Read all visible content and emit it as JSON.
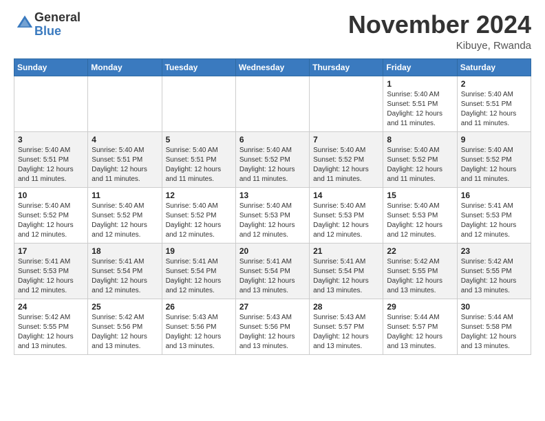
{
  "header": {
    "logo_line1": "General",
    "logo_line2": "Blue",
    "month": "November 2024",
    "location": "Kibuye, Rwanda"
  },
  "days_of_week": [
    "Sunday",
    "Monday",
    "Tuesday",
    "Wednesday",
    "Thursday",
    "Friday",
    "Saturday"
  ],
  "weeks": [
    [
      {
        "day": "",
        "info": ""
      },
      {
        "day": "",
        "info": ""
      },
      {
        "day": "",
        "info": ""
      },
      {
        "day": "",
        "info": ""
      },
      {
        "day": "",
        "info": ""
      },
      {
        "day": "1",
        "info": "Sunrise: 5:40 AM\nSunset: 5:51 PM\nDaylight: 12 hours\nand 11 minutes."
      },
      {
        "day": "2",
        "info": "Sunrise: 5:40 AM\nSunset: 5:51 PM\nDaylight: 12 hours\nand 11 minutes."
      }
    ],
    [
      {
        "day": "3",
        "info": "Sunrise: 5:40 AM\nSunset: 5:51 PM\nDaylight: 12 hours\nand 11 minutes."
      },
      {
        "day": "4",
        "info": "Sunrise: 5:40 AM\nSunset: 5:51 PM\nDaylight: 12 hours\nand 11 minutes."
      },
      {
        "day": "5",
        "info": "Sunrise: 5:40 AM\nSunset: 5:51 PM\nDaylight: 12 hours\nand 11 minutes."
      },
      {
        "day": "6",
        "info": "Sunrise: 5:40 AM\nSunset: 5:52 PM\nDaylight: 12 hours\nand 11 minutes."
      },
      {
        "day": "7",
        "info": "Sunrise: 5:40 AM\nSunset: 5:52 PM\nDaylight: 12 hours\nand 11 minutes."
      },
      {
        "day": "8",
        "info": "Sunrise: 5:40 AM\nSunset: 5:52 PM\nDaylight: 12 hours\nand 11 minutes."
      },
      {
        "day": "9",
        "info": "Sunrise: 5:40 AM\nSunset: 5:52 PM\nDaylight: 12 hours\nand 11 minutes."
      }
    ],
    [
      {
        "day": "10",
        "info": "Sunrise: 5:40 AM\nSunset: 5:52 PM\nDaylight: 12 hours\nand 12 minutes."
      },
      {
        "day": "11",
        "info": "Sunrise: 5:40 AM\nSunset: 5:52 PM\nDaylight: 12 hours\nand 12 minutes."
      },
      {
        "day": "12",
        "info": "Sunrise: 5:40 AM\nSunset: 5:52 PM\nDaylight: 12 hours\nand 12 minutes."
      },
      {
        "day": "13",
        "info": "Sunrise: 5:40 AM\nSunset: 5:53 PM\nDaylight: 12 hours\nand 12 minutes."
      },
      {
        "day": "14",
        "info": "Sunrise: 5:40 AM\nSunset: 5:53 PM\nDaylight: 12 hours\nand 12 minutes."
      },
      {
        "day": "15",
        "info": "Sunrise: 5:40 AM\nSunset: 5:53 PM\nDaylight: 12 hours\nand 12 minutes."
      },
      {
        "day": "16",
        "info": "Sunrise: 5:41 AM\nSunset: 5:53 PM\nDaylight: 12 hours\nand 12 minutes."
      }
    ],
    [
      {
        "day": "17",
        "info": "Sunrise: 5:41 AM\nSunset: 5:53 PM\nDaylight: 12 hours\nand 12 minutes."
      },
      {
        "day": "18",
        "info": "Sunrise: 5:41 AM\nSunset: 5:54 PM\nDaylight: 12 hours\nand 12 minutes."
      },
      {
        "day": "19",
        "info": "Sunrise: 5:41 AM\nSunset: 5:54 PM\nDaylight: 12 hours\nand 12 minutes."
      },
      {
        "day": "20",
        "info": "Sunrise: 5:41 AM\nSunset: 5:54 PM\nDaylight: 12 hours\nand 13 minutes."
      },
      {
        "day": "21",
        "info": "Sunrise: 5:41 AM\nSunset: 5:54 PM\nDaylight: 12 hours\nand 13 minutes."
      },
      {
        "day": "22",
        "info": "Sunrise: 5:42 AM\nSunset: 5:55 PM\nDaylight: 12 hours\nand 13 minutes."
      },
      {
        "day": "23",
        "info": "Sunrise: 5:42 AM\nSunset: 5:55 PM\nDaylight: 12 hours\nand 13 minutes."
      }
    ],
    [
      {
        "day": "24",
        "info": "Sunrise: 5:42 AM\nSunset: 5:55 PM\nDaylight: 12 hours\nand 13 minutes."
      },
      {
        "day": "25",
        "info": "Sunrise: 5:42 AM\nSunset: 5:56 PM\nDaylight: 12 hours\nand 13 minutes."
      },
      {
        "day": "26",
        "info": "Sunrise: 5:43 AM\nSunset: 5:56 PM\nDaylight: 12 hours\nand 13 minutes."
      },
      {
        "day": "27",
        "info": "Sunrise: 5:43 AM\nSunset: 5:56 PM\nDaylight: 12 hours\nand 13 minutes."
      },
      {
        "day": "28",
        "info": "Sunrise: 5:43 AM\nSunset: 5:57 PM\nDaylight: 12 hours\nand 13 minutes."
      },
      {
        "day": "29",
        "info": "Sunrise: 5:44 AM\nSunset: 5:57 PM\nDaylight: 12 hours\nand 13 minutes."
      },
      {
        "day": "30",
        "info": "Sunrise: 5:44 AM\nSunset: 5:58 PM\nDaylight: 12 hours\nand 13 minutes."
      }
    ]
  ]
}
